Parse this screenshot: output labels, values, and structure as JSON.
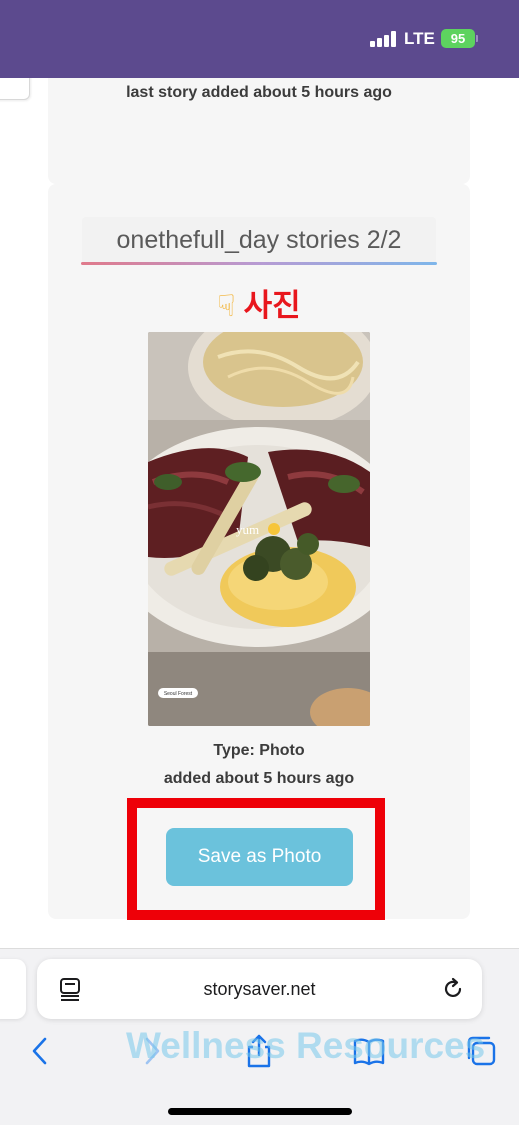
{
  "status_bar": {
    "network": "LTE",
    "battery": "95"
  },
  "cards": {
    "previous_summary": "last story added about 5 hours ago",
    "story": {
      "title": "onethefull_day stories 2/2",
      "media_label": "사진",
      "media_label_icon": "pointing-hand-down-icon",
      "photo_caption": "yum",
      "photo_tag": "Seoul Forest",
      "type": "Type: Photo",
      "added": "added about 5 hours ago",
      "save_label": "Save as Photo"
    }
  },
  "browser": {
    "url": "storysaver.net",
    "watermark": "Wellness Resources"
  },
  "colors": {
    "status_bar_bg": "#5c4a8e",
    "save_button": "#6bc2dc",
    "highlight": "#ee0008",
    "media_label": "#e8161c",
    "browser_accent": "#1a73e8"
  }
}
